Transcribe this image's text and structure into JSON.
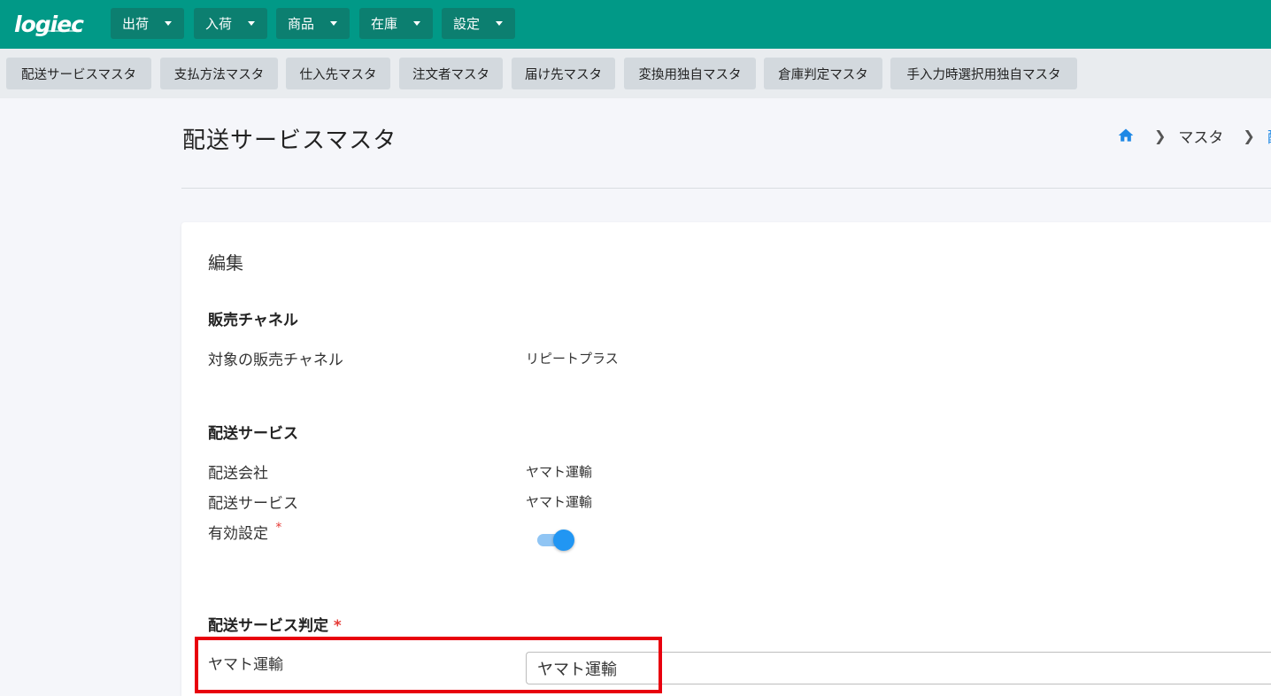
{
  "app": {
    "logo": "logiec"
  },
  "top_menu": [
    {
      "label": "出荷"
    },
    {
      "label": "入荷"
    },
    {
      "label": "商品"
    },
    {
      "label": "在庫"
    },
    {
      "label": "設定"
    }
  ],
  "sub_menu": [
    {
      "label": "配送サービスマスタ"
    },
    {
      "label": "支払方法マスタ"
    },
    {
      "label": "仕入先マスタ"
    },
    {
      "label": "注文者マスタ"
    },
    {
      "label": "届け先マスタ"
    },
    {
      "label": "変換用独自マスタ"
    },
    {
      "label": "倉庫判定マスタ"
    },
    {
      "label": "手入力時選択用独自マスタ"
    }
  ],
  "page": {
    "title": "配送サービスマスタ",
    "breadcrumb": [
      "マスタ",
      "配"
    ]
  },
  "card": {
    "title": "編集",
    "sales_channel": {
      "heading": "販売チャネル",
      "target_label": "対象の販売チャネル",
      "target_value": "リピートプラス"
    },
    "delivery_service": {
      "heading": "配送サービス",
      "company_label": "配送会社",
      "company_value": "ヤマト運輸",
      "service_label": "配送サービス",
      "service_value": "ヤマト運輸",
      "enabled_label": "有効設定",
      "required_mark": "*",
      "enabled": true
    },
    "judgement": {
      "heading": "配送サービス判定",
      "required_mark": "*",
      "row_label": "ヤマト運輸",
      "input_value": "ヤマト運輸"
    }
  },
  "colors": {
    "header": "#019987",
    "menu_button": "#0c7f70",
    "toggle": "#2196f3",
    "highlight": "#e8000e"
  },
  "icons": {
    "home": "home-icon",
    "breadcrumb_separator": "chevron-right-icon",
    "menu_dropdown": "caret-down-icon"
  }
}
